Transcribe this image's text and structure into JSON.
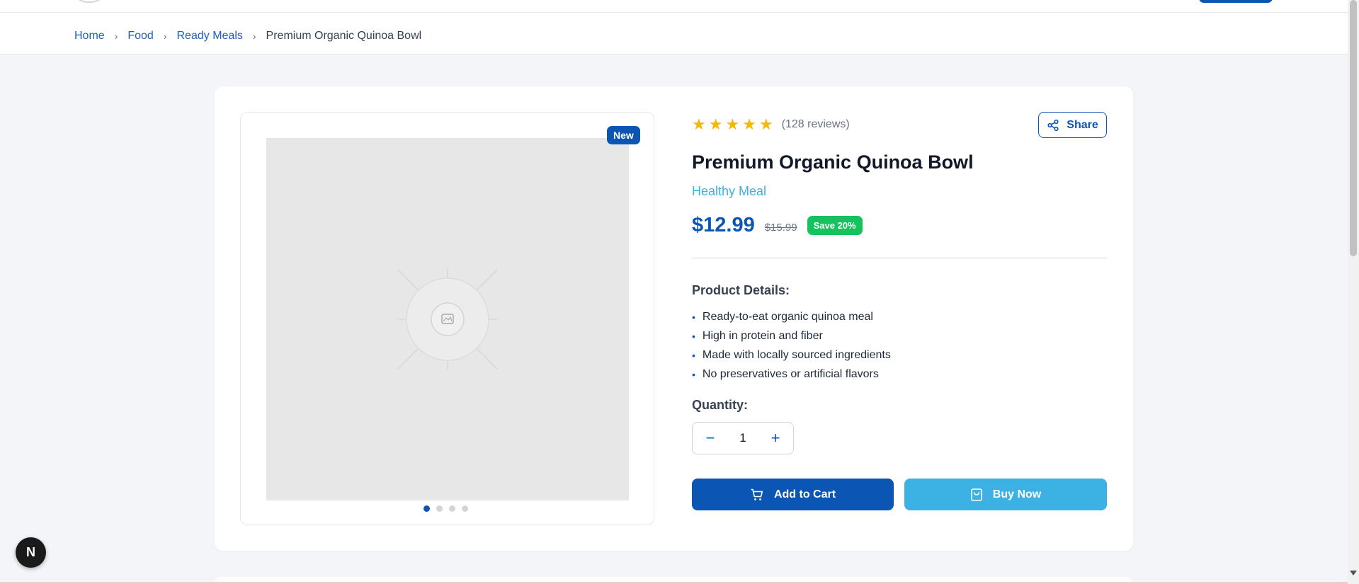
{
  "breadcrumb": {
    "items": [
      "Home",
      "Food",
      "Ready Meals"
    ],
    "current": "Premium Organic Quinoa Bowl"
  },
  "gallery": {
    "badge": "New",
    "dot_count": 4,
    "active_dot": 0
  },
  "product": {
    "rating": 5,
    "reviews": "(128 reviews)",
    "share_label": "Share",
    "title": "Premium Organic Quinoa Bowl",
    "category": "Healthy Meal",
    "price": "$12.99",
    "old_price": "$15.99",
    "save_badge": "Save 20%",
    "details_heading": "Product Details:",
    "details": [
      "Ready-to-eat organic quinoa meal",
      "High in protein and fiber",
      "Made with locally sourced ingredients",
      "No preservatives or artificial flavors"
    ],
    "quantity_heading": "Quantity:",
    "quantity": "1",
    "add_to_cart": "Add to Cart",
    "buy_now": "Buy Now"
  },
  "dev_indicator": "N",
  "colors": {
    "primary": "#0b55b5",
    "accent": "#3bb2e3",
    "save_green": "#16c25b",
    "star": "#f5b800"
  }
}
